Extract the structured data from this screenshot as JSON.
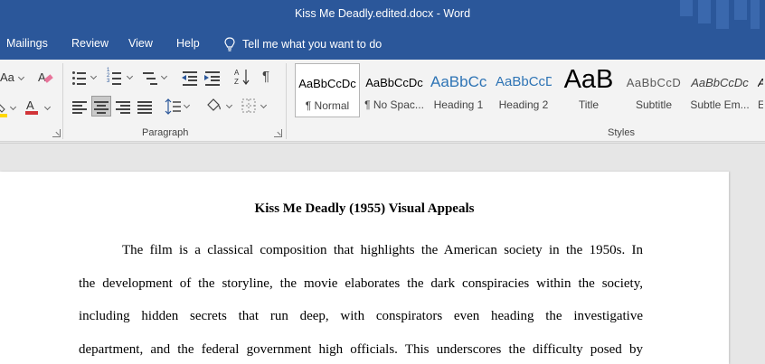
{
  "window": {
    "title": "Kiss Me Deadly.edited.docx  -  Word"
  },
  "ribbon_tabs": [
    "Mailings",
    "Review",
    "View",
    "Help"
  ],
  "tell_me": "Tell me what you want to do",
  "font_group": {
    "change_case": "Aa"
  },
  "groups": {
    "paragraph": "Paragraph",
    "styles": "Styles"
  },
  "styles": [
    {
      "preview": "AaBbCcDc",
      "name": "¶ Normal"
    },
    {
      "preview": "AaBbCcDc",
      "name": "¶ No Spac..."
    },
    {
      "preview": "AaBbCc",
      "name": "Heading 1"
    },
    {
      "preview": "AaBbCcD",
      "name": "Heading 2"
    },
    {
      "preview": "AaB",
      "name": "Title"
    },
    {
      "preview": "AaBbCcD",
      "name": "Subtitle"
    },
    {
      "preview": "AaBbCcDc",
      "name": "Subtle Em..."
    },
    {
      "preview": "A",
      "name": "E"
    }
  ],
  "document": {
    "title": "Kiss Me Deadly (1955) Visual Appeals",
    "lines": [
      "The film is a classical composition that highlights the American society in the 1950s. In",
      "the development of the storyline, the movie elaborates the dark conspiracies within the society,",
      "including hidden secrets that run deep, with conspirators even heading the investigative",
      "department, and the federal government high officials. This underscores the difficulty posed by"
    ]
  },
  "colors": {
    "titlebar": "#2b579a",
    "ribbon": "#f3f3f3",
    "font_color_red": "#d13438",
    "highlight_yellow": "#ffd800",
    "heading_blue": "#2e74b5"
  }
}
